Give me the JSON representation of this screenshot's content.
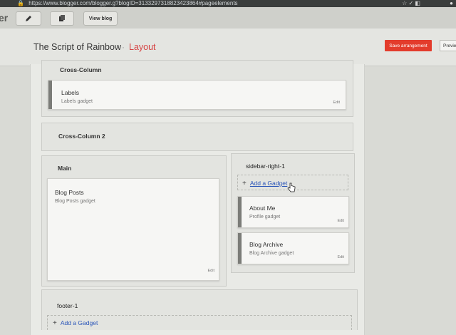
{
  "browser": {
    "url": "https://www.blogger.com/blogger.g?blogID=3133297318823423864#pageelements"
  },
  "toolbar": {
    "logo": "er",
    "view_blog": "View blog"
  },
  "header": {
    "blog_title": "The Script of Rainbow",
    "separator": "·",
    "section_title": "Layout",
    "save_button": "Save arrangement",
    "preview_button": "Previe"
  },
  "layout": {
    "cross_column": {
      "title": "Cross-Column",
      "gadget": {
        "title": "Labels",
        "subtitle": "Labels gadget",
        "edit": "Edit"
      }
    },
    "cross_column_2": {
      "title": "Cross-Column 2"
    },
    "main": {
      "title": "Main",
      "gadget": {
        "title": "Blog Posts",
        "subtitle": "Blog Posts gadget",
        "edit": "Edit"
      }
    },
    "sidebar": {
      "title": "sidebar-right-1",
      "add_gadget": "Add a Gadget",
      "gadgets": [
        {
          "title": "About Me",
          "subtitle": "Profile gadget",
          "edit": "Edit"
        },
        {
          "title": "Blog Archive",
          "subtitle": "Blog Archive gadget",
          "edit": "Edit"
        }
      ]
    },
    "footer": {
      "title": "footer-1",
      "add_gadget": "Add a Gadget"
    }
  },
  "colors": {
    "accent_red": "#e33c2c",
    "layout_red": "#d64545",
    "link_blue": "#2a55b8"
  }
}
